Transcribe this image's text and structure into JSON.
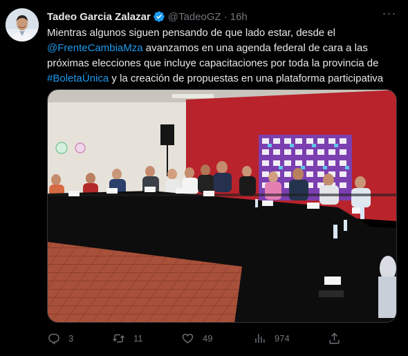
{
  "tweet": {
    "author_name": "Tadeo Garcia Zalazar",
    "handle": "@TadeoGZ",
    "separator": "·",
    "time": "16h",
    "text_1": "Mientras algunos siguen pensando de que lado estar, desde el",
    "mention": "@FrenteCambiaMza",
    "text_2": " avanzamos en una agenda federal de cara a las próximas elecciones que incluye capacitaciones por toda la provincia de ",
    "hashtag": "#BoletaÚnica",
    "text_3": " y la creación de propuestas en una plataforma participativa",
    "more_label": "···"
  },
  "actions": {
    "replies": "3",
    "retweets": "11",
    "likes": "49",
    "views": "974"
  },
  "icons": {
    "verified": "verified-badge-icon",
    "reply": "reply-icon",
    "retweet": "retweet-icon",
    "like": "heart-icon",
    "views": "views-icon",
    "share": "share-icon"
  },
  "colors": {
    "background": "#000000",
    "text": "#e7e9ea",
    "secondary": "#71767b",
    "link": "#1d9bf0",
    "wall_red": "#b8232c",
    "tablecloth": "#0d0d0d",
    "floor_tile": "#a8503a"
  }
}
